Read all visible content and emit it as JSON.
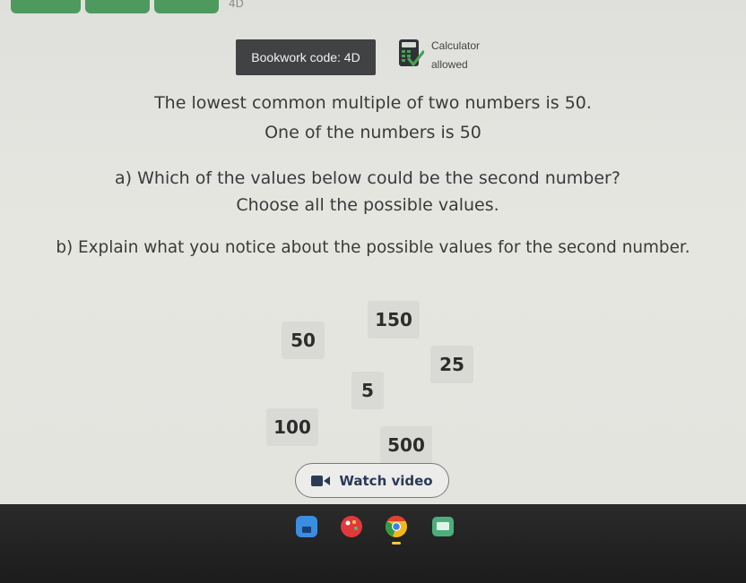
{
  "header": {
    "tab_fragment": "4D",
    "bookwork_code": "Bookwork code: 4D",
    "calculator_line1": "Calculator",
    "calculator_line2": "allowed"
  },
  "question": {
    "line1": "The lowest common multiple of two numbers is 50.",
    "line2": "One of the numbers is 50",
    "part_a": "a) Which of the values below could be the second number?",
    "part_a_sub": "Choose all the possible values.",
    "part_b": "b) Explain what you notice about the possible values for the second number."
  },
  "values": [
    "150",
    "50",
    "25",
    "5",
    "100",
    "500"
  ],
  "watch_video": {
    "label": "Watch video",
    "icon": "video-camera-icon"
  },
  "taskbar": {
    "icons": [
      "files-app-icon",
      "paint-app-icon",
      "chrome-browser-icon",
      "screen-app-icon"
    ]
  },
  "colors": {
    "badge_bg": "#404244",
    "tab_green": "#4e9a5e",
    "button_text": "#2b3a57",
    "taskbar": "#1f1f1f"
  }
}
